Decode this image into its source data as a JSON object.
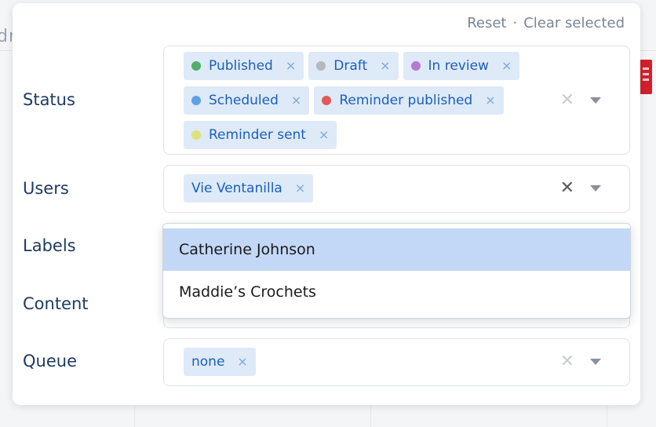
{
  "background": {
    "partial_text": "dn"
  },
  "header": {
    "reset_label": "Reset",
    "separator": "·",
    "clear_selected_label": "Clear selected"
  },
  "filters": {
    "status": {
      "label": "Status",
      "chips": [
        {
          "text": "Published",
          "color": "#4caf6a"
        },
        {
          "text": "Draft",
          "color": "#b5b8bd"
        },
        {
          "text": "In review",
          "color": "#b57ad3"
        },
        {
          "text": "Scheduled",
          "color": "#5ea2e6"
        },
        {
          "text": "Reminder published",
          "color": "#e05a5a"
        },
        {
          "text": "Reminder sent",
          "color": "#dbe37a"
        }
      ]
    },
    "users": {
      "label": "Users",
      "chips": [
        {
          "text": "Vie Ventanilla"
        }
      ]
    },
    "labels": {
      "label": "Labels"
    },
    "content": {
      "label": "Content"
    },
    "queue": {
      "label": "Queue",
      "chips": [
        {
          "text": "none"
        }
      ]
    }
  },
  "dropdown": {
    "options": [
      "Catherine Johnson",
      "Maddie’s Crochets"
    ],
    "highlighted_index": 0
  },
  "icons": {
    "remove": "×",
    "clear": "✕",
    "caret": "chevron-down-icon"
  }
}
